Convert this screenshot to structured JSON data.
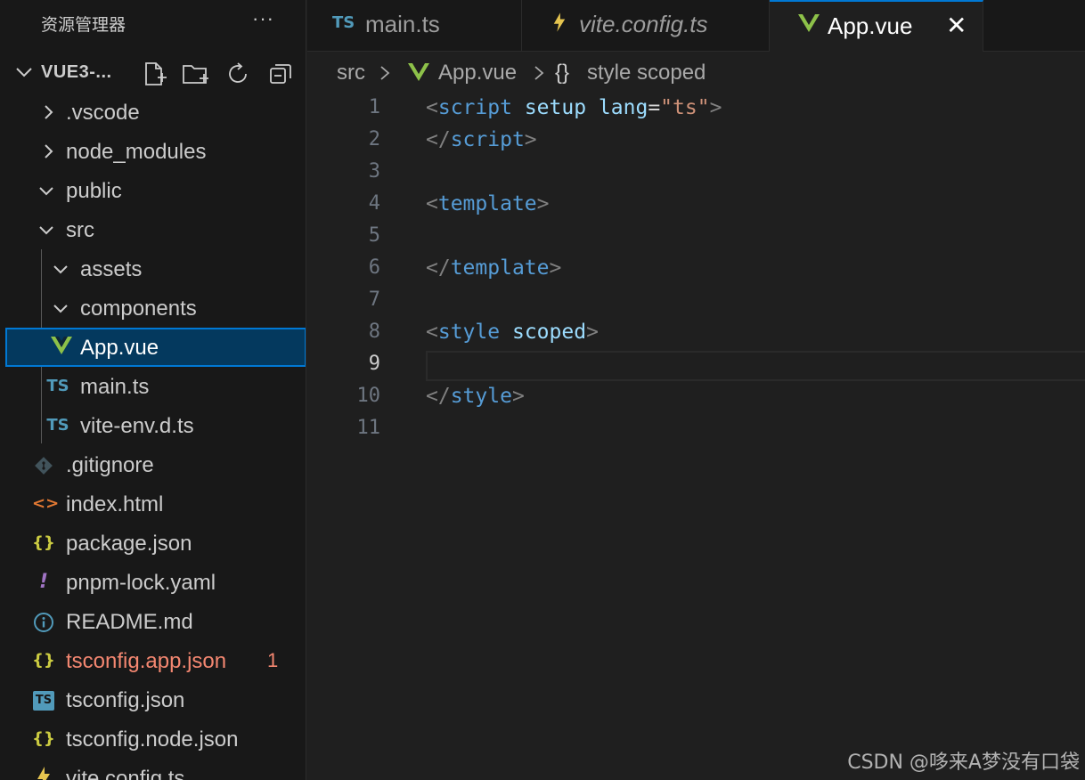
{
  "sidebar": {
    "title": "资源管理器",
    "more": "···",
    "project": "VUE3-...",
    "items": [
      {
        "label": ".vscode",
        "type": "folder",
        "expanded": false
      },
      {
        "label": "node_modules",
        "type": "folder",
        "expanded": false
      },
      {
        "label": "public",
        "type": "folder",
        "expanded": true
      },
      {
        "label": "src",
        "type": "folder",
        "expanded": true
      },
      {
        "label": "assets",
        "type": "folder",
        "expanded": true
      },
      {
        "label": "components",
        "type": "folder",
        "expanded": true
      },
      {
        "label": "App.vue",
        "type": "vue",
        "selected": true
      },
      {
        "label": "main.ts",
        "type": "ts",
        "icon_text": "TS"
      },
      {
        "label": "vite-env.d.ts",
        "type": "ts",
        "icon_text": "TS"
      },
      {
        "label": ".gitignore",
        "type": "git"
      },
      {
        "label": "index.html",
        "type": "html",
        "icon_text": "<>"
      },
      {
        "label": "package.json",
        "type": "json",
        "icon_text": "{}"
      },
      {
        "label": "pnpm-lock.yaml",
        "type": "yaml",
        "icon_text": "!"
      },
      {
        "label": "README.md",
        "type": "info"
      },
      {
        "label": "tsconfig.app.json",
        "type": "json",
        "icon_text": "{}",
        "error": true,
        "badge": "1"
      },
      {
        "label": "tsconfig.json",
        "type": "tsconfig",
        "icon_text": "TS"
      },
      {
        "label": "tsconfig.node.json",
        "type": "json",
        "icon_text": "{}"
      },
      {
        "label": "vite.config.ts",
        "type": "vite"
      }
    ]
  },
  "tabs": [
    {
      "label": "main.ts",
      "icon_text": "TS",
      "active": false,
      "italic": false
    },
    {
      "label": "vite.config.ts",
      "active": false,
      "italic": true
    },
    {
      "label": "App.vue",
      "active": true,
      "italic": false,
      "close": "✕"
    }
  ],
  "breadcrumb": {
    "folder": "src",
    "file": "App.vue",
    "symbol_icon": "{}",
    "symbol": "style scoped"
  },
  "editor": {
    "current_line": 9,
    "lines": [
      {
        "n": "1",
        "tokens": [
          [
            "punc",
            "<"
          ],
          [
            "tag",
            "script"
          ],
          [
            "plain",
            " "
          ],
          [
            "attr",
            "setup"
          ],
          [
            "plain",
            " "
          ],
          [
            "attr",
            "lang"
          ],
          [
            "eq",
            "="
          ],
          [
            "str",
            "\"ts\""
          ],
          [
            "punc",
            ">"
          ]
        ]
      },
      {
        "n": "2",
        "tokens": [
          [
            "punc",
            "</"
          ],
          [
            "tag",
            "script"
          ],
          [
            "punc",
            ">"
          ]
        ]
      },
      {
        "n": "3",
        "tokens": []
      },
      {
        "n": "4",
        "tokens": [
          [
            "punc",
            "<"
          ],
          [
            "tag",
            "template"
          ],
          [
            "punc",
            ">"
          ]
        ]
      },
      {
        "n": "5",
        "tokens": []
      },
      {
        "n": "6",
        "tokens": [
          [
            "punc",
            "</"
          ],
          [
            "tag",
            "template"
          ],
          [
            "punc",
            ">"
          ]
        ]
      },
      {
        "n": "7",
        "tokens": []
      },
      {
        "n": "8",
        "tokens": [
          [
            "punc",
            "<"
          ],
          [
            "tag",
            "style"
          ],
          [
            "plain",
            " "
          ],
          [
            "attr",
            "scoped"
          ],
          [
            "punc",
            ">"
          ]
        ]
      },
      {
        "n": "9",
        "tokens": []
      },
      {
        "n": "10",
        "tokens": [
          [
            "punc",
            "</"
          ],
          [
            "tag",
            "style"
          ],
          [
            "punc",
            ">"
          ]
        ]
      },
      {
        "n": "11",
        "tokens": []
      }
    ]
  },
  "watermark": "CSDN @哆来A梦没有口袋",
  "colors": {
    "ts": "#519aba",
    "vue": "#8dc149",
    "vite": "#e5c44f",
    "json": "#cbcb41",
    "html": "#e37933",
    "yaml": "#a074c4",
    "info": "#519aba",
    "git": "#41535b",
    "error": "#f48771",
    "accent": "#0078d4"
  }
}
